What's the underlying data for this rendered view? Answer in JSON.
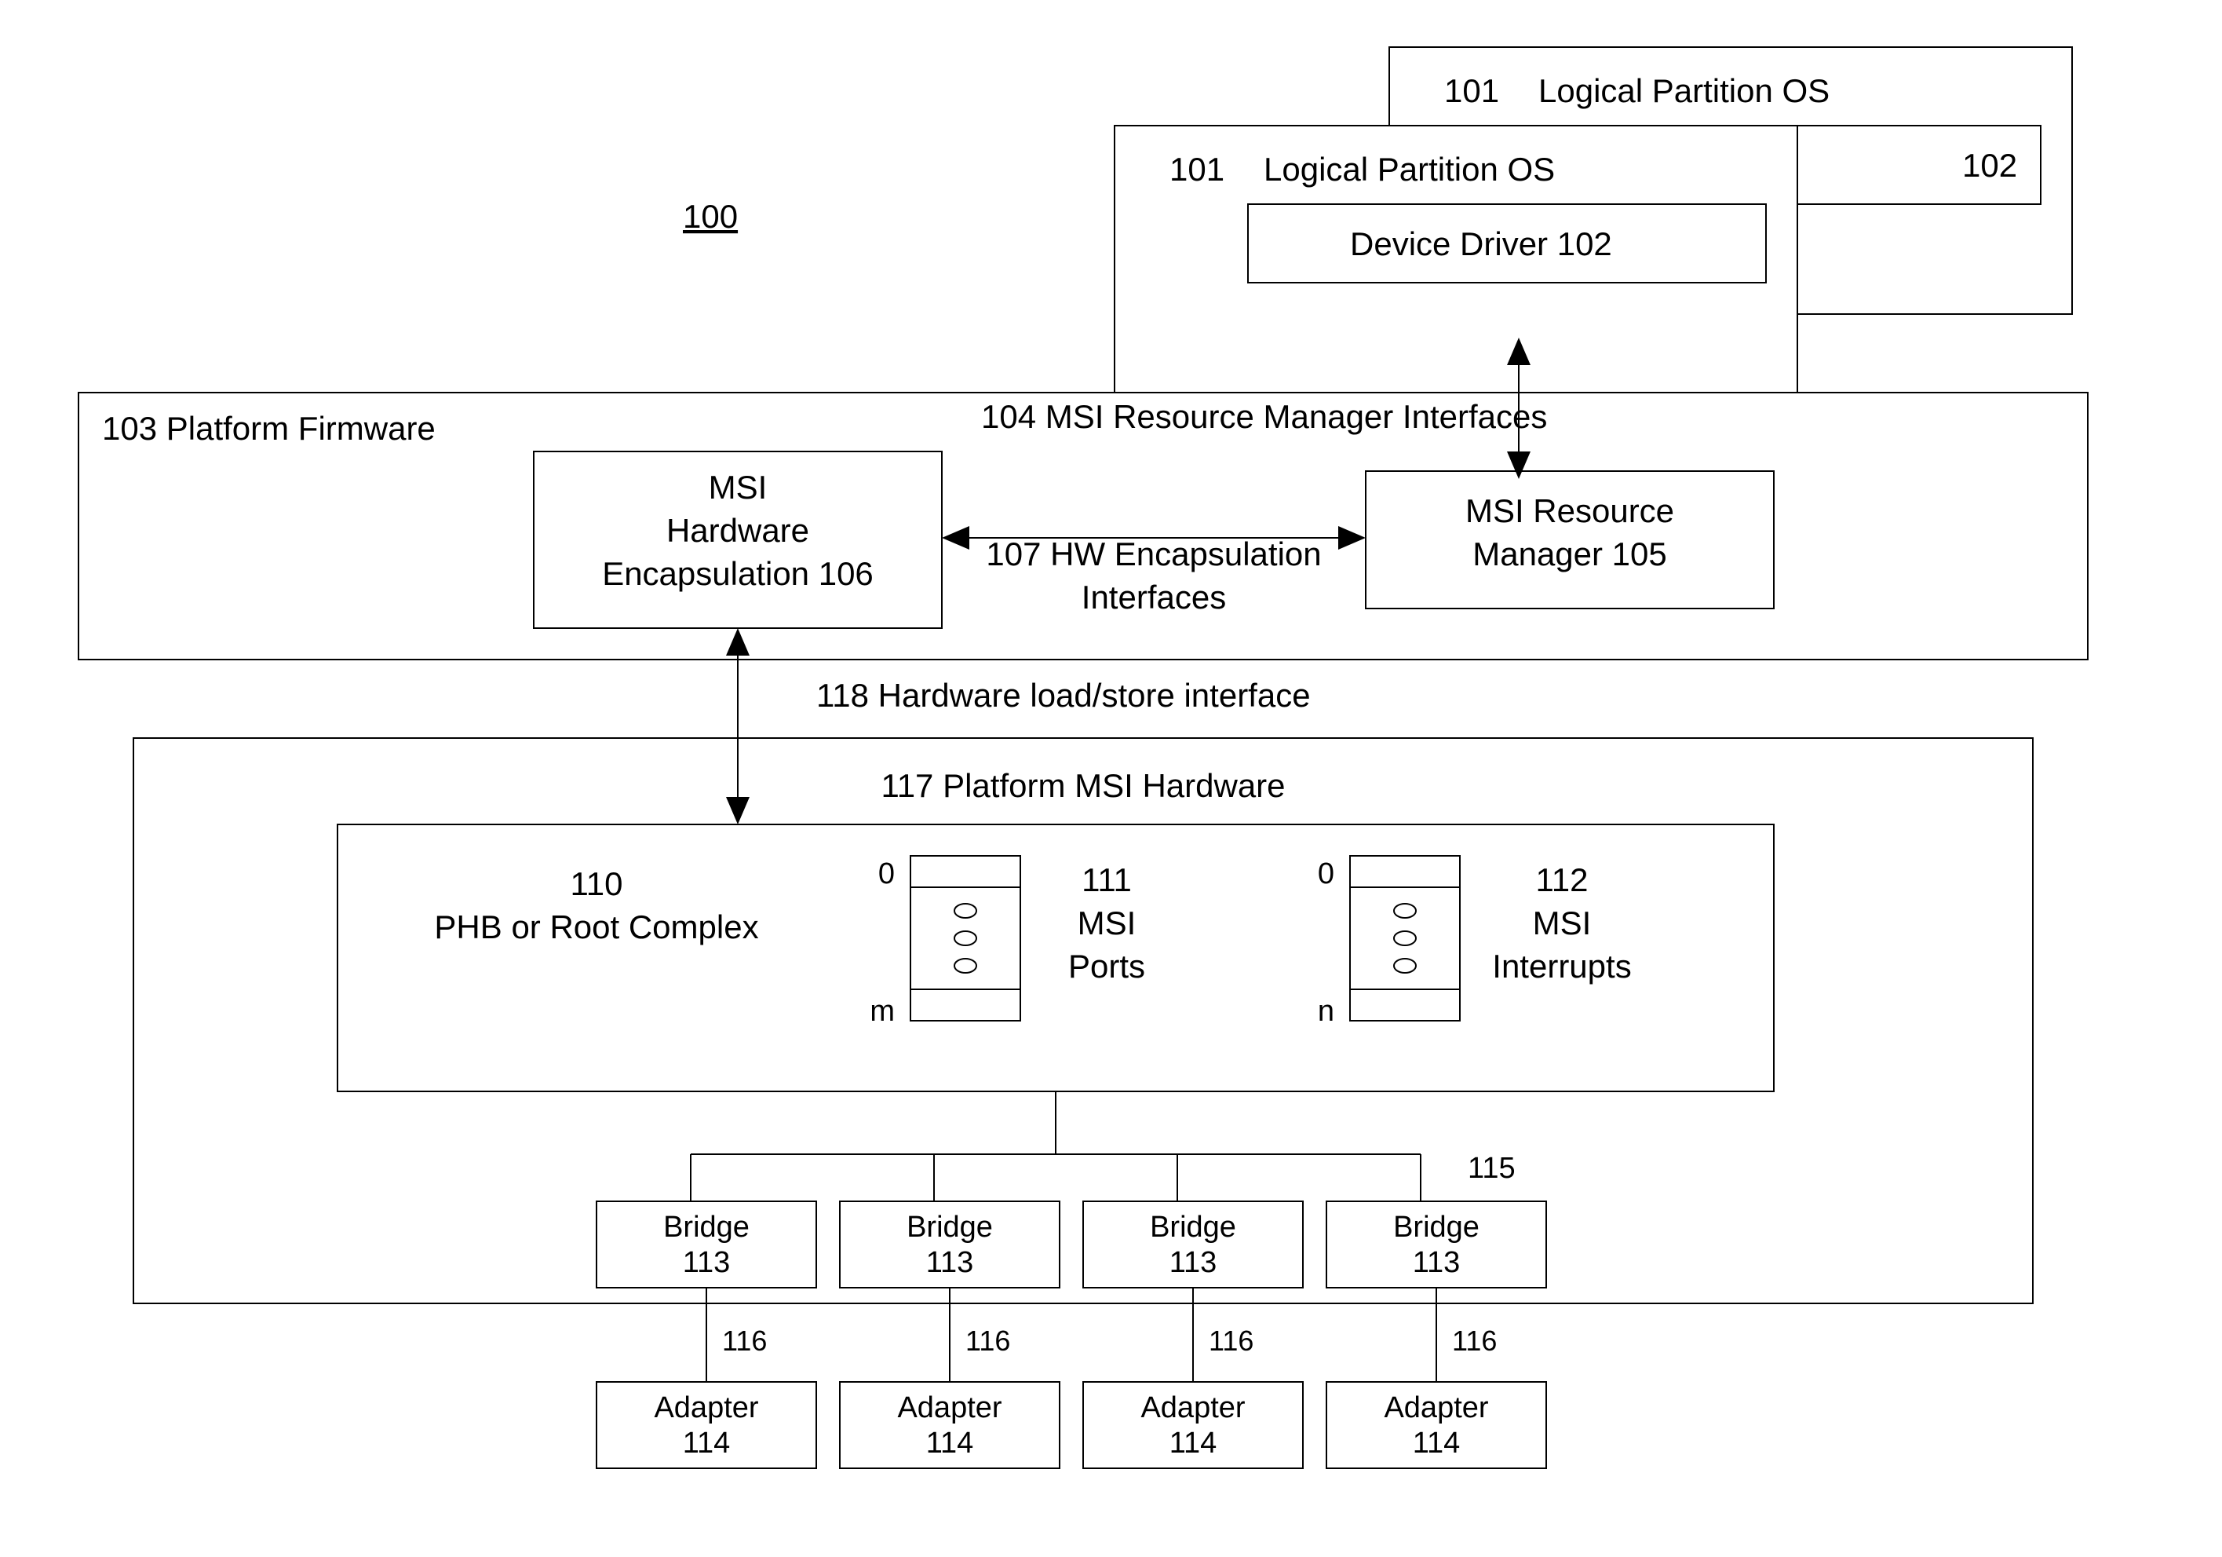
{
  "diagram_ref": "100",
  "logical_partition_back": {
    "ref": "101",
    "title": "Logical Partition OS",
    "driver_ref": "102"
  },
  "logical_partition_front": {
    "ref": "101",
    "title": "Logical Partition OS",
    "driver_label": "Device Driver 102"
  },
  "firmware": {
    "ref": "103",
    "title": "Platform Firmware",
    "encapsulation_line1": "MSI",
    "encapsulation_line2": "Hardware",
    "encapsulation_line3": "Encapsulation 106",
    "manager_line1": "MSI Resource",
    "manager_line2": "Manager 105"
  },
  "interfaces": {
    "msi_rm": "104 MSI Resource Manager Interfaces",
    "hw_encap_line1": "107 HW Encapsulation",
    "hw_encap_line2": "Interfaces",
    "load_store": "118 Hardware load/store interface"
  },
  "hardware": {
    "title": "117 Platform MSI Hardware",
    "phb_ref": "110",
    "phb_label": "PHB or Root Complex",
    "ports_ref": "111",
    "ports_line1": "MSI",
    "ports_line2": "Ports",
    "ports_top": "0",
    "ports_bottom": "m",
    "ints_ref": "112",
    "ints_line1": "MSI",
    "ints_line2": "Interrupts",
    "ints_top": "0",
    "ints_bottom": "n"
  },
  "tree_label": "115",
  "bridges": [
    {
      "label": "Bridge",
      "ref": "113"
    },
    {
      "label": "Bridge",
      "ref": "113"
    },
    {
      "label": "Bridge",
      "ref": "113"
    },
    {
      "label": "Bridge",
      "ref": "113"
    }
  ],
  "adapters": [
    {
      "label": "Adapter",
      "ref": "114",
      "conn": "116"
    },
    {
      "label": "Adapter",
      "ref": "114",
      "conn": "116"
    },
    {
      "label": "Adapter",
      "ref": "114",
      "conn": "116"
    },
    {
      "label": "Adapter",
      "ref": "114",
      "conn": "116"
    }
  ]
}
